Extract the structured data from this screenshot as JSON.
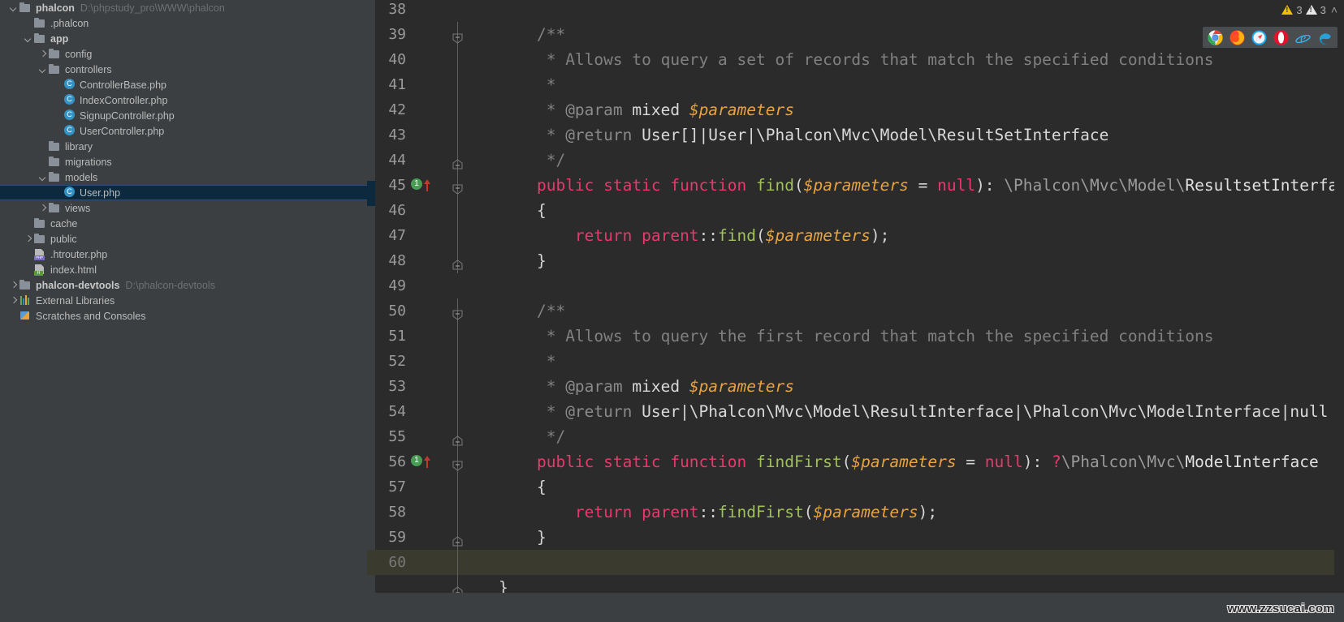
{
  "sidebar": {
    "items": [
      {
        "indent": 0,
        "twisty": "down",
        "icon": "folder-icon",
        "label": "phalcon",
        "bold": true,
        "path": "D:\\phpstudy_pro\\WWW\\phalcon",
        "selected": false
      },
      {
        "indent": 1,
        "twisty": "none",
        "icon": "folder-icon",
        "label": ".phalcon",
        "bold": false,
        "path": "",
        "selected": false
      },
      {
        "indent": 1,
        "twisty": "down",
        "icon": "folder-icon",
        "label": "app",
        "bold": true,
        "path": "",
        "selected": false
      },
      {
        "indent": 2,
        "twisty": "right",
        "icon": "folder-icon",
        "label": "config",
        "bold": false,
        "path": "",
        "selected": false
      },
      {
        "indent": 2,
        "twisty": "down",
        "icon": "folder-icon",
        "label": "controllers",
        "bold": false,
        "path": "",
        "selected": false
      },
      {
        "indent": 3,
        "twisty": "none",
        "icon": "php-class-icon",
        "label": "ControllerBase.php",
        "bold": false,
        "path": "",
        "selected": false
      },
      {
        "indent": 3,
        "twisty": "none",
        "icon": "php-class-icon",
        "label": "IndexController.php",
        "bold": false,
        "path": "",
        "selected": false
      },
      {
        "indent": 3,
        "twisty": "none",
        "icon": "php-class-icon",
        "label": "SignupController.php",
        "bold": false,
        "path": "",
        "selected": false
      },
      {
        "indent": 3,
        "twisty": "none",
        "icon": "php-class-icon",
        "label": "UserController.php",
        "bold": false,
        "path": "",
        "selected": false
      },
      {
        "indent": 2,
        "twisty": "none",
        "icon": "folder-icon",
        "label": "library",
        "bold": false,
        "path": "",
        "selected": false
      },
      {
        "indent": 2,
        "twisty": "none",
        "icon": "folder-icon",
        "label": "migrations",
        "bold": false,
        "path": "",
        "selected": false
      },
      {
        "indent": 2,
        "twisty": "down",
        "icon": "folder-icon",
        "label": "models",
        "bold": false,
        "path": "",
        "selected": false
      },
      {
        "indent": 3,
        "twisty": "none",
        "icon": "php-class-icon",
        "label": "User.php",
        "bold": false,
        "path": "",
        "selected": true
      },
      {
        "indent": 2,
        "twisty": "right",
        "icon": "folder-icon",
        "label": "views",
        "bold": false,
        "path": "",
        "selected": false
      },
      {
        "indent": 1,
        "twisty": "none",
        "icon": "folder-icon",
        "label": "cache",
        "bold": false,
        "path": "",
        "selected": false
      },
      {
        "indent": 1,
        "twisty": "right",
        "icon": "folder-icon",
        "label": "public",
        "bold": false,
        "path": "",
        "selected": false
      },
      {
        "indent": 1,
        "twisty": "none",
        "icon": "php-file-icon",
        "label": ".htrouter.php",
        "bold": false,
        "path": "",
        "selected": false
      },
      {
        "indent": 1,
        "twisty": "none",
        "icon": "html-file-icon",
        "label": "index.html",
        "bold": false,
        "path": "",
        "selected": false
      },
      {
        "indent": 0,
        "twisty": "right",
        "icon": "folder-icon",
        "label": "phalcon-devtools",
        "bold": true,
        "path": "D:\\phalcon-devtools",
        "selected": false
      },
      {
        "indent": 0,
        "twisty": "right",
        "icon": "external-libraries-icon",
        "label": "External Libraries",
        "bold": false,
        "path": "",
        "selected": false
      },
      {
        "indent": 0,
        "twisty": "none",
        "icon": "scratches-icon",
        "label": "Scratches and Consoles",
        "bold": false,
        "path": "",
        "selected": false
      }
    ]
  },
  "inspections": {
    "warning_count": "3",
    "error_count": "3",
    "collapse_chevron": "˄"
  },
  "browsers": [
    {
      "name": "chrome-icon",
      "color": "#4ab14a"
    },
    {
      "name": "firefox-icon",
      "color": "#ff7139"
    },
    {
      "name": "safari-icon",
      "color": "#45a3f5"
    },
    {
      "name": "opera-icon",
      "color": "#e8112d"
    },
    {
      "name": "internet-explorer-icon",
      "color": "#2fa8e0"
    },
    {
      "name": "edge-icon",
      "color": "#0f9dd8"
    }
  ],
  "editor": {
    "current_line": "60",
    "lines": [
      {
        "no": "38",
        "fold": "none",
        "marker": false,
        "current": false,
        "tokens": []
      },
      {
        "no": "39",
        "fold": "open",
        "marker": false,
        "current": false,
        "tokens": [
          {
            "t": "    ",
            "c": "punc"
          },
          {
            "t": "/**",
            "c": "cmt"
          }
        ]
      },
      {
        "no": "40",
        "fold": "rail",
        "marker": false,
        "current": false,
        "tokens": [
          {
            "t": "     * ",
            "c": "cmt"
          },
          {
            "t": "Allows to query a set of records that match the specified conditions",
            "c": "cmt"
          }
        ]
      },
      {
        "no": "41",
        "fold": "rail",
        "marker": false,
        "current": false,
        "tokens": [
          {
            "t": "     *",
            "c": "cmt"
          }
        ]
      },
      {
        "no": "42",
        "fold": "rail",
        "marker": false,
        "current": false,
        "tokens": [
          {
            "t": "     * ",
            "c": "cmt"
          },
          {
            "t": "@param ",
            "c": "cmttag"
          },
          {
            "t": "mixed ",
            "c": "cmtb"
          },
          {
            "t": "$parameters",
            "c": "var"
          }
        ]
      },
      {
        "no": "43",
        "fold": "rail",
        "marker": false,
        "current": false,
        "tokens": [
          {
            "t": "     * ",
            "c": "cmt"
          },
          {
            "t": "@return ",
            "c": "cmttag"
          },
          {
            "t": "User[]|User|\\Phalcon\\Mvc\\Model\\ResultSetInterface",
            "c": "cmtb"
          }
        ]
      },
      {
        "no": "44",
        "fold": "close",
        "marker": false,
        "current": false,
        "tokens": [
          {
            "t": "     */",
            "c": "cmt"
          }
        ]
      },
      {
        "no": "45",
        "fold": "open",
        "marker": true,
        "current": false,
        "tokens": [
          {
            "t": "    ",
            "c": "punc"
          },
          {
            "t": "public static function ",
            "c": "kwp"
          },
          {
            "t": "find",
            "c": "fn"
          },
          {
            "t": "(",
            "c": "punc"
          },
          {
            "t": "$parameters",
            "c": "var"
          },
          {
            "t": " = ",
            "c": "punc"
          },
          {
            "t": "null",
            "c": "nul"
          },
          {
            "t": "): ",
            "c": "punc"
          },
          {
            "t": "\\Phalcon\\Mvc\\Model\\",
            "c": "type"
          },
          {
            "t": "ResultsetInterface",
            "c": "typeb"
          }
        ]
      },
      {
        "no": "46",
        "fold": "rail",
        "marker": false,
        "current": false,
        "tokens": [
          {
            "t": "    {",
            "c": "punc"
          }
        ]
      },
      {
        "no": "47",
        "fold": "rail",
        "marker": false,
        "current": false,
        "tokens": [
          {
            "t": "        ",
            "c": "punc"
          },
          {
            "t": "return ",
            "c": "kwp"
          },
          {
            "t": "parent",
            "c": "kwp"
          },
          {
            "t": "::",
            "c": "punc"
          },
          {
            "t": "find",
            "c": "fn"
          },
          {
            "t": "(",
            "c": "punc"
          },
          {
            "t": "$parameters",
            "c": "var"
          },
          {
            "t": ");",
            "c": "punc"
          }
        ]
      },
      {
        "no": "48",
        "fold": "close",
        "marker": false,
        "current": false,
        "tokens": [
          {
            "t": "    }",
            "c": "punc"
          }
        ]
      },
      {
        "no": "49",
        "fold": "none",
        "marker": false,
        "current": false,
        "tokens": []
      },
      {
        "no": "50",
        "fold": "open",
        "marker": false,
        "current": false,
        "tokens": [
          {
            "t": "    ",
            "c": "punc"
          },
          {
            "t": "/**",
            "c": "cmt"
          }
        ]
      },
      {
        "no": "51",
        "fold": "rail",
        "marker": false,
        "current": false,
        "tokens": [
          {
            "t": "     * ",
            "c": "cmt"
          },
          {
            "t": "Allows to query the first record that match the specified conditions",
            "c": "cmt"
          }
        ]
      },
      {
        "no": "52",
        "fold": "rail",
        "marker": false,
        "current": false,
        "tokens": [
          {
            "t": "     *",
            "c": "cmt"
          }
        ]
      },
      {
        "no": "53",
        "fold": "rail",
        "marker": false,
        "current": false,
        "tokens": [
          {
            "t": "     * ",
            "c": "cmt"
          },
          {
            "t": "@param ",
            "c": "cmttag"
          },
          {
            "t": "mixed ",
            "c": "cmtb"
          },
          {
            "t": "$parameters",
            "c": "var"
          }
        ]
      },
      {
        "no": "54",
        "fold": "rail",
        "marker": false,
        "current": false,
        "tokens": [
          {
            "t": "     * ",
            "c": "cmt"
          },
          {
            "t": "@return ",
            "c": "cmttag"
          },
          {
            "t": "User|\\Phalcon\\Mvc\\Model\\ResultInterface|\\Phalcon\\Mvc\\ModelInterface|null",
            "c": "cmtb"
          }
        ]
      },
      {
        "no": "55",
        "fold": "close",
        "marker": false,
        "current": false,
        "tokens": [
          {
            "t": "     */",
            "c": "cmt"
          }
        ]
      },
      {
        "no": "56",
        "fold": "open",
        "marker": true,
        "current": false,
        "tokens": [
          {
            "t": "    ",
            "c": "punc"
          },
          {
            "t": "public static function ",
            "c": "kwp"
          },
          {
            "t": "findFirst",
            "c": "fn"
          },
          {
            "t": "(",
            "c": "punc"
          },
          {
            "t": "$parameters",
            "c": "var"
          },
          {
            "t": " = ",
            "c": "punc"
          },
          {
            "t": "null",
            "c": "nul"
          },
          {
            "t": "): ",
            "c": "punc"
          },
          {
            "t": "?",
            "c": "nul"
          },
          {
            "t": "\\Phalcon\\Mvc\\",
            "c": "type"
          },
          {
            "t": "ModelInterface",
            "c": "typeb"
          }
        ]
      },
      {
        "no": "57",
        "fold": "rail",
        "marker": false,
        "current": false,
        "tokens": [
          {
            "t": "    {",
            "c": "punc"
          }
        ]
      },
      {
        "no": "58",
        "fold": "rail",
        "marker": false,
        "current": false,
        "tokens": [
          {
            "t": "        ",
            "c": "punc"
          },
          {
            "t": "return ",
            "c": "kwp"
          },
          {
            "t": "parent",
            "c": "kwp"
          },
          {
            "t": "::",
            "c": "punc"
          },
          {
            "t": "findFirst",
            "c": "fn"
          },
          {
            "t": "(",
            "c": "punc"
          },
          {
            "t": "$parameters",
            "c": "var"
          },
          {
            "t": ");",
            "c": "punc"
          }
        ]
      },
      {
        "no": "59",
        "fold": "close",
        "marker": false,
        "current": false,
        "tokens": [
          {
            "t": "    }",
            "c": "punc"
          }
        ]
      },
      {
        "no": "60",
        "fold": "rail",
        "marker": false,
        "current": true,
        "tokens": []
      },
      {
        "no": "",
        "fold": "close",
        "marker": false,
        "current": false,
        "tokens": [
          {
            "t": "}",
            "c": "punc"
          }
        ]
      }
    ]
  },
  "watermark": {
    "text": "www.zzsucai.com"
  }
}
